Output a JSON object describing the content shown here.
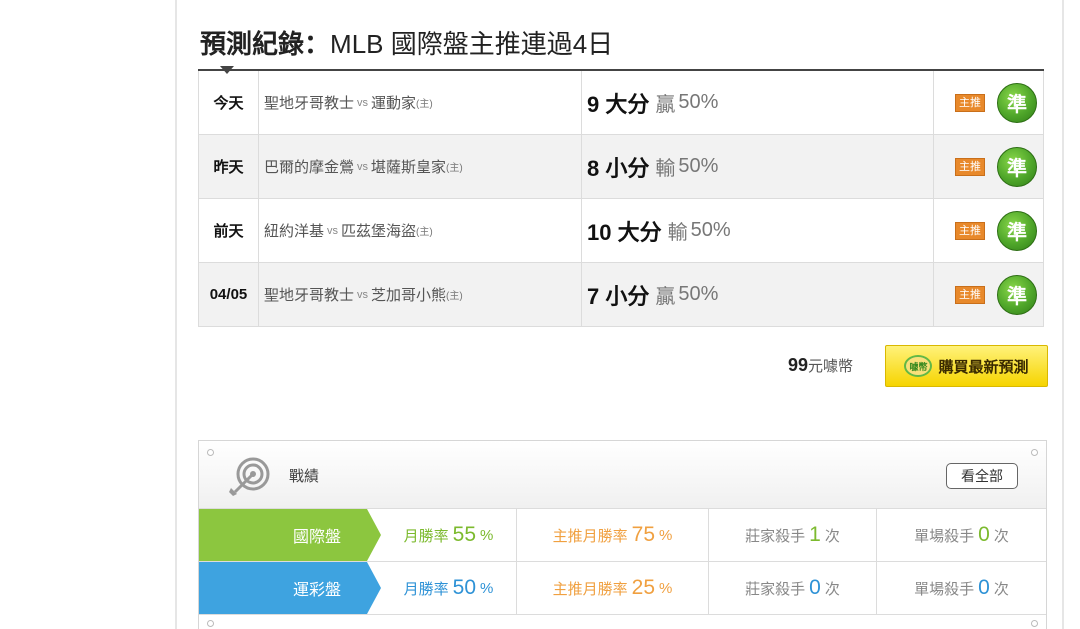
{
  "title": {
    "bold": "預測紀錄",
    "sep": "：",
    "text": "MLB 國際盤主推連過4日"
  },
  "rows": [
    {
      "date": "今天",
      "away": "聖地牙哥教士",
      "vs": "vs",
      "home": "運動家",
      "host_mark": "(主)",
      "pick": "9 大分",
      "result": "贏",
      "pct": "50%",
      "badge": "主推",
      "icon": "準"
    },
    {
      "date": "昨天",
      "away": "巴爾的摩金鶯",
      "vs": "vs",
      "home": "堪薩斯皇家",
      "host_mark": "(主)",
      "pick": "8 小分",
      "result": "輸",
      "pct": "50%",
      "badge": "主推",
      "icon": "準"
    },
    {
      "date": "前天",
      "away": "紐約洋基",
      "vs": "vs",
      "home": "匹茲堡海盜",
      "host_mark": "(主)",
      "pick": "10 大分",
      "result": "輸",
      "pct": "50%",
      "badge": "主推",
      "icon": "準"
    },
    {
      "date": "04/05",
      "away": "聖地牙哥教士",
      "vs": "vs",
      "home": "芝加哥小熊",
      "host_mark": "(主)",
      "pick": "7 小分",
      "result": "贏",
      "pct": "50%",
      "badge": "主推",
      "icon": "準"
    }
  ],
  "purchase": {
    "price": "99",
    "unit": "元噱幣",
    "button": "購買最新預測",
    "coin": "噱幣"
  },
  "record": {
    "title": "戰績",
    "see_all": "看全部",
    "stats": [
      {
        "label": "國際盤",
        "month_rate_label": "月勝率",
        "month_rate": "55",
        "main_rate_label": "主推月勝率",
        "main_rate": "75",
        "dealer_label": "莊家殺手",
        "dealer": "1",
        "single_label": "單場殺手",
        "single": "0",
        "unit_pct": "%",
        "unit_times": "次"
      },
      {
        "label": "運彩盤",
        "month_rate_label": "月勝率",
        "month_rate": "50",
        "main_rate_label": "主推月勝率",
        "main_rate": "25",
        "dealer_label": "莊家殺手",
        "dealer": "0",
        "single_label": "單場殺手",
        "single": "0",
        "unit_pct": "%",
        "unit_times": "次"
      }
    ]
  },
  "colors": {
    "green": "#8cc63f",
    "blue": "#3ea3e0",
    "orange": "#f0a040",
    "badge": "#e8892b",
    "button": "#f6d400"
  }
}
